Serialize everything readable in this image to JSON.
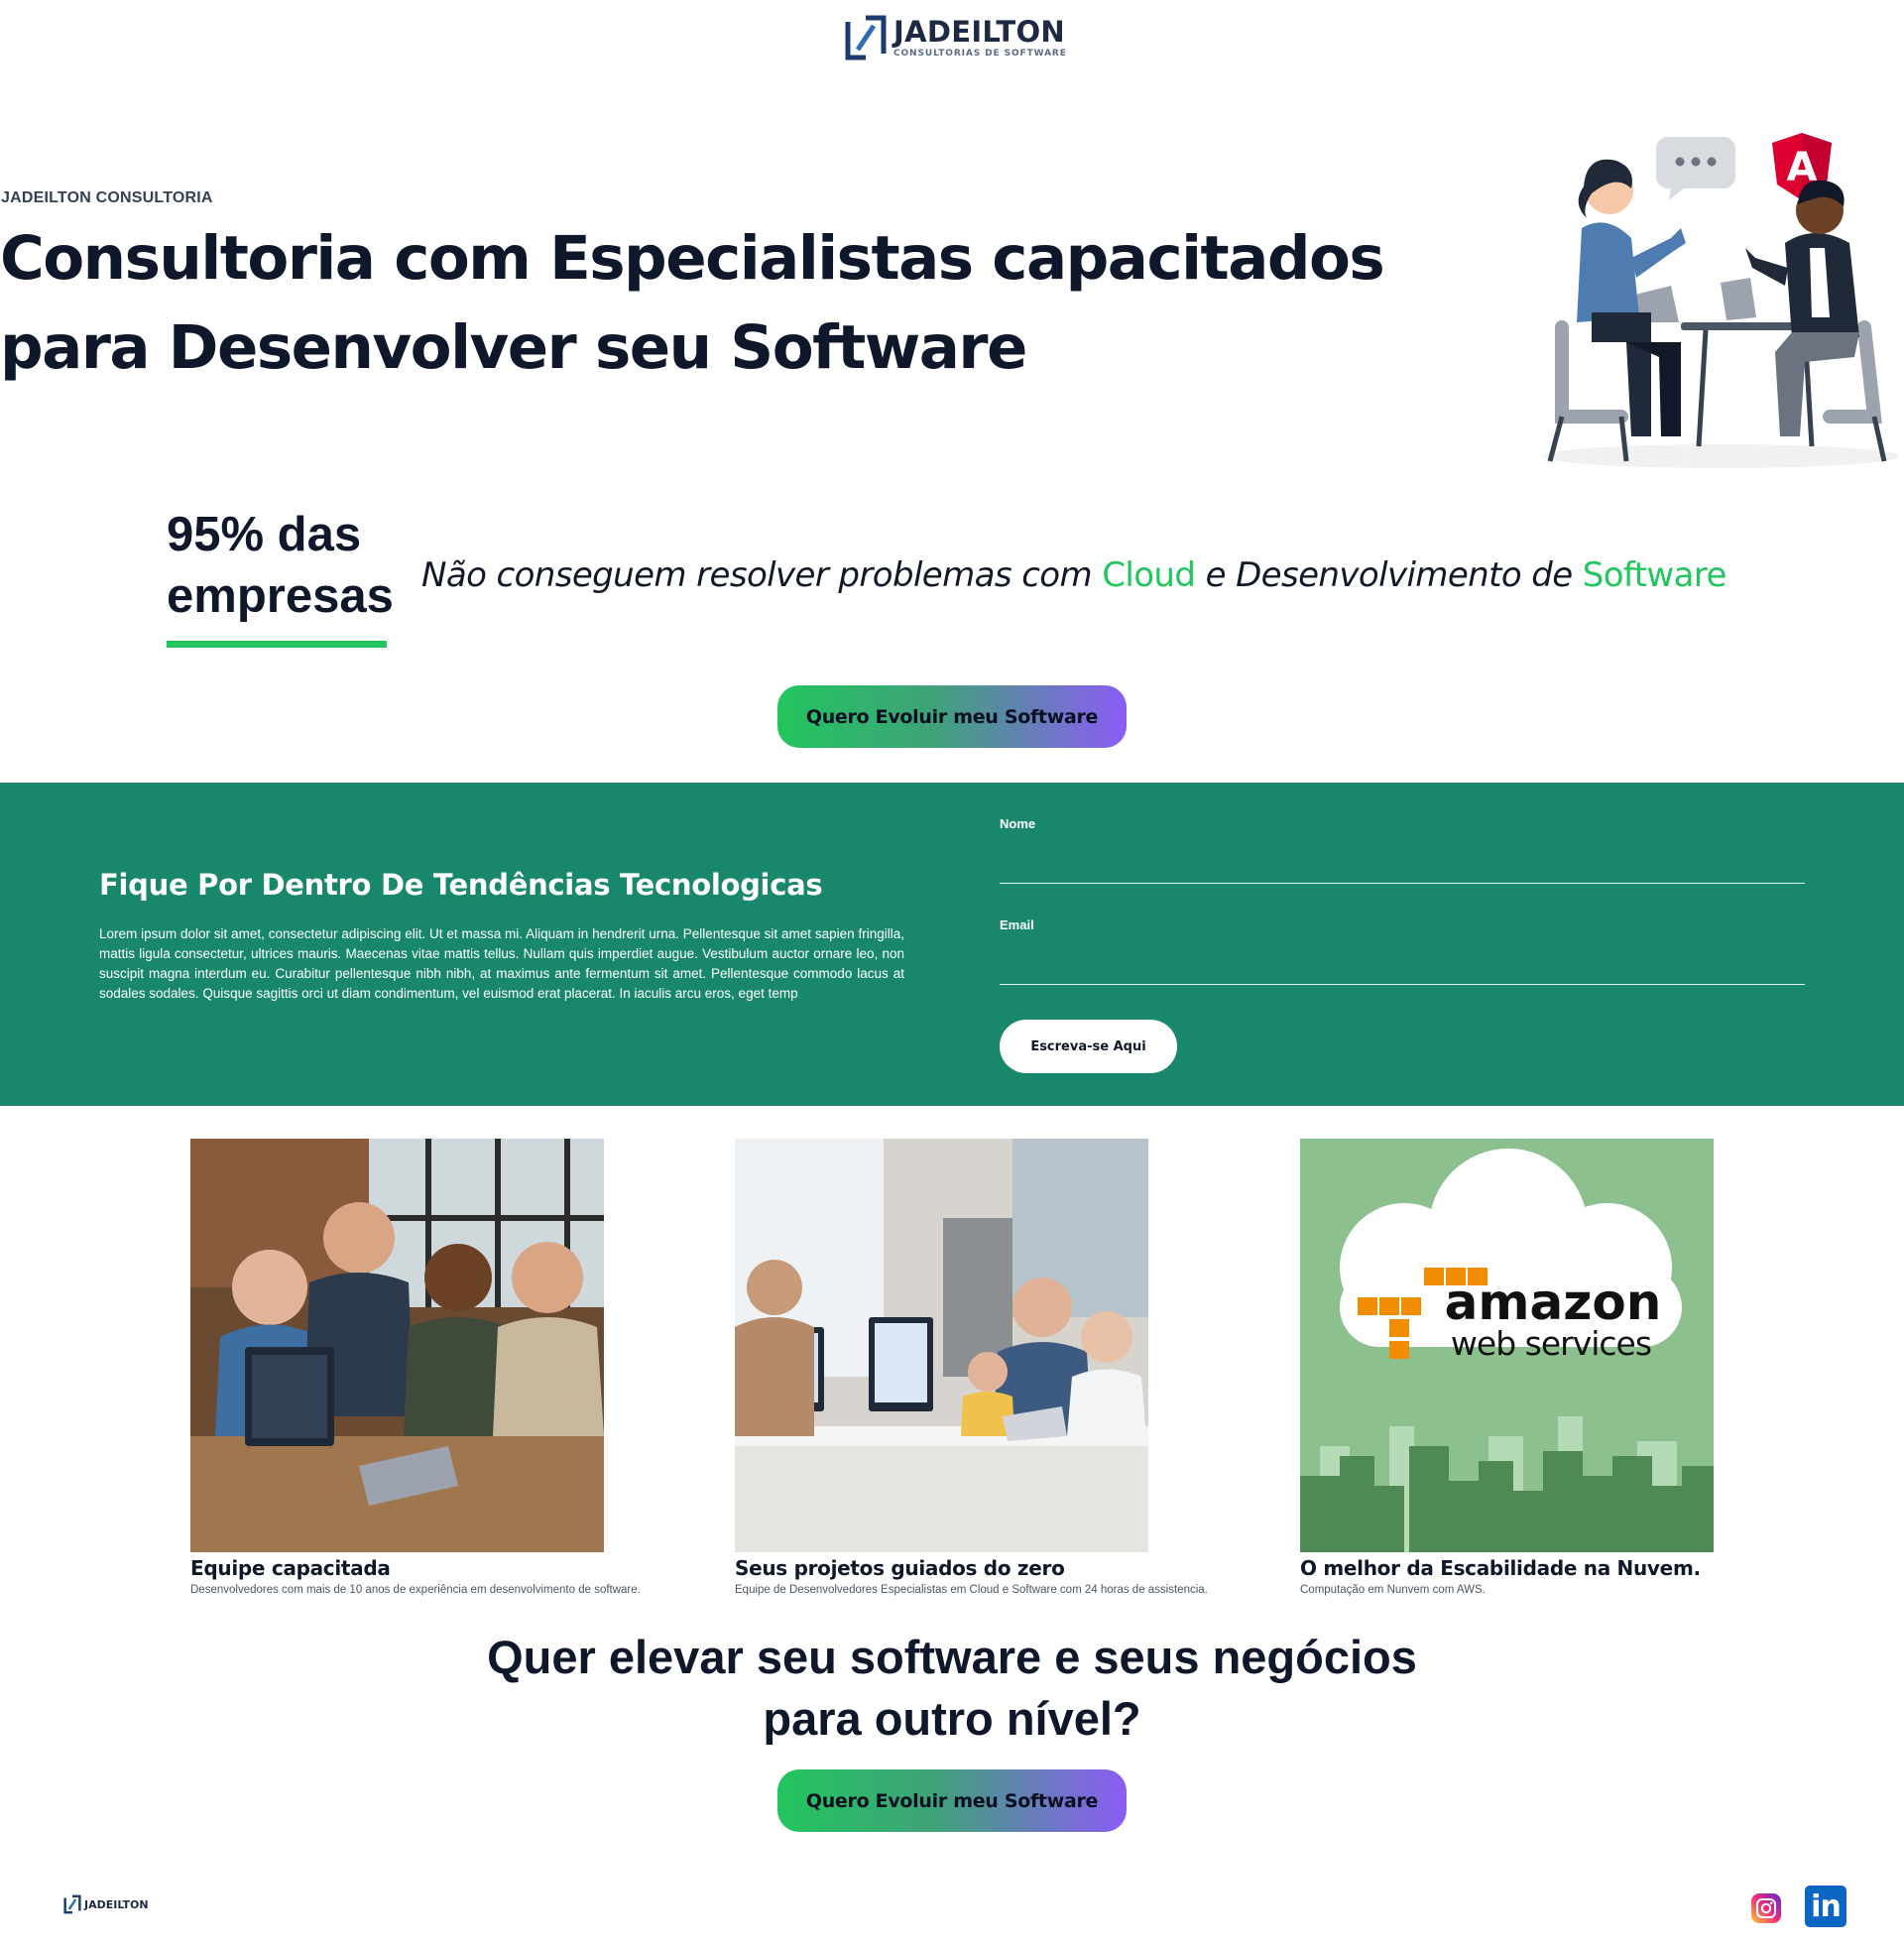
{
  "header": {
    "logo_name": "JADEILTON",
    "logo_tagline": "CONSULTORIAS DE SOFTWARE"
  },
  "hero": {
    "eyebrow": "JADEILTON CONSULTORIA",
    "title": "Consultoria com Especialistas capacitados para Desenvolver seu Software",
    "illustration_badge": "A"
  },
  "stat": {
    "number": "95% das empresas",
    "text_part1": "Não conseguem resolver problemas com ",
    "highlight1": "Cloud",
    "text_part2": " e Desenvolvimento de ",
    "highlight2": "Software"
  },
  "cta": {
    "label": "Quero Evoluir meu Software"
  },
  "newsletter": {
    "title": "Fique Por Dentro De Tendências Tecnologicas",
    "body": "Lorem ipsum dolor sit amet, consectetur adipiscing elit. Ut et massa mi. Aliquam in hendrerit urna. Pellentesque sit amet sapien fringilla, mattis ligula consectetur, ultrices mauris. Maecenas vitae mattis tellus. Nullam quis imperdiet augue. Vestibulum auctor ornare leo, non suscipit magna interdum eu. Curabitur pellentesque nibh nibh, at maximus ante fermentum sit amet. Pellentesque commodo lacus at sodales sodales. Quisque sagittis orci ut diam condimentum, vel euismod erat placerat. In iaculis arcu eros, eget temp",
    "name_label": "Nome",
    "name_value": "",
    "email_label": "Email",
    "email_value": "",
    "submit_label": "Escreva-se Aqui"
  },
  "features": [
    {
      "title": "Equipe capacitada",
      "description": "Desenvolvedores com mais de 10 anos de experiência em desenvolvimento de software."
    },
    {
      "title": "Seus projetos guiados do zero",
      "description": "Equipe de Desenvolvedores Especialistas em Cloud e Software com 24 horas de assistencia."
    },
    {
      "title": "O melhor da Escabilidade na Nuvem.",
      "description": "Computação em Nunvem com AWS.",
      "image_text_1": "amazon",
      "image_text_2": "web services"
    }
  ],
  "closing": {
    "title": "Quer elevar seu software e seus negócios para outro nível?"
  },
  "footer": {
    "logo_name": "JADEILTON",
    "linkedin_label": "in"
  },
  "colors": {
    "accent_green": "#22c55e",
    "band_green": "#18876b",
    "gradient_end": "#8b5cf6",
    "navy": "#0f172a"
  },
  "icons": [
    "logo-mark-icon",
    "angular-icon",
    "chat-bubble-icon",
    "instagram-icon",
    "linkedin-icon"
  ]
}
